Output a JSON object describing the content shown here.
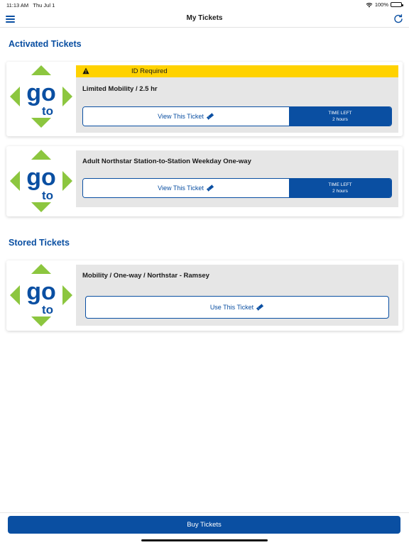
{
  "status": {
    "time": "11:13 AM",
    "date": "Thu Jul 1",
    "battery": "100%"
  },
  "nav": {
    "title": "My Tickets"
  },
  "sections": {
    "activated": "Activated Tickets",
    "stored": "Stored Tickets"
  },
  "activated_tickets": [
    {
      "warning": "ID Required",
      "name": "Limited Mobility / 2.5 hr",
      "view_label": "View This Ticket",
      "time_left_label": "TIME LEFT",
      "time_left_value": "2 hours"
    },
    {
      "name": "Adult Northstar Station-to-Station Weekday One-way",
      "view_label": "View This Ticket",
      "time_left_label": "TIME LEFT",
      "time_left_value": "2 hours"
    }
  ],
  "stored_tickets": [
    {
      "name": "Mobility / One-way / Northstar - Ramsey",
      "use_label": "Use This Ticket"
    }
  ],
  "footer": {
    "buy_label": "Buy Tickets"
  },
  "logo": {
    "text_top": "go",
    "text_bottom": "to"
  },
  "colors": {
    "brand_blue": "#0a4fa2",
    "logo_green": "#8cc63f",
    "warning_yellow": "#ffd200",
    "card_gray": "#e6e6e6"
  }
}
